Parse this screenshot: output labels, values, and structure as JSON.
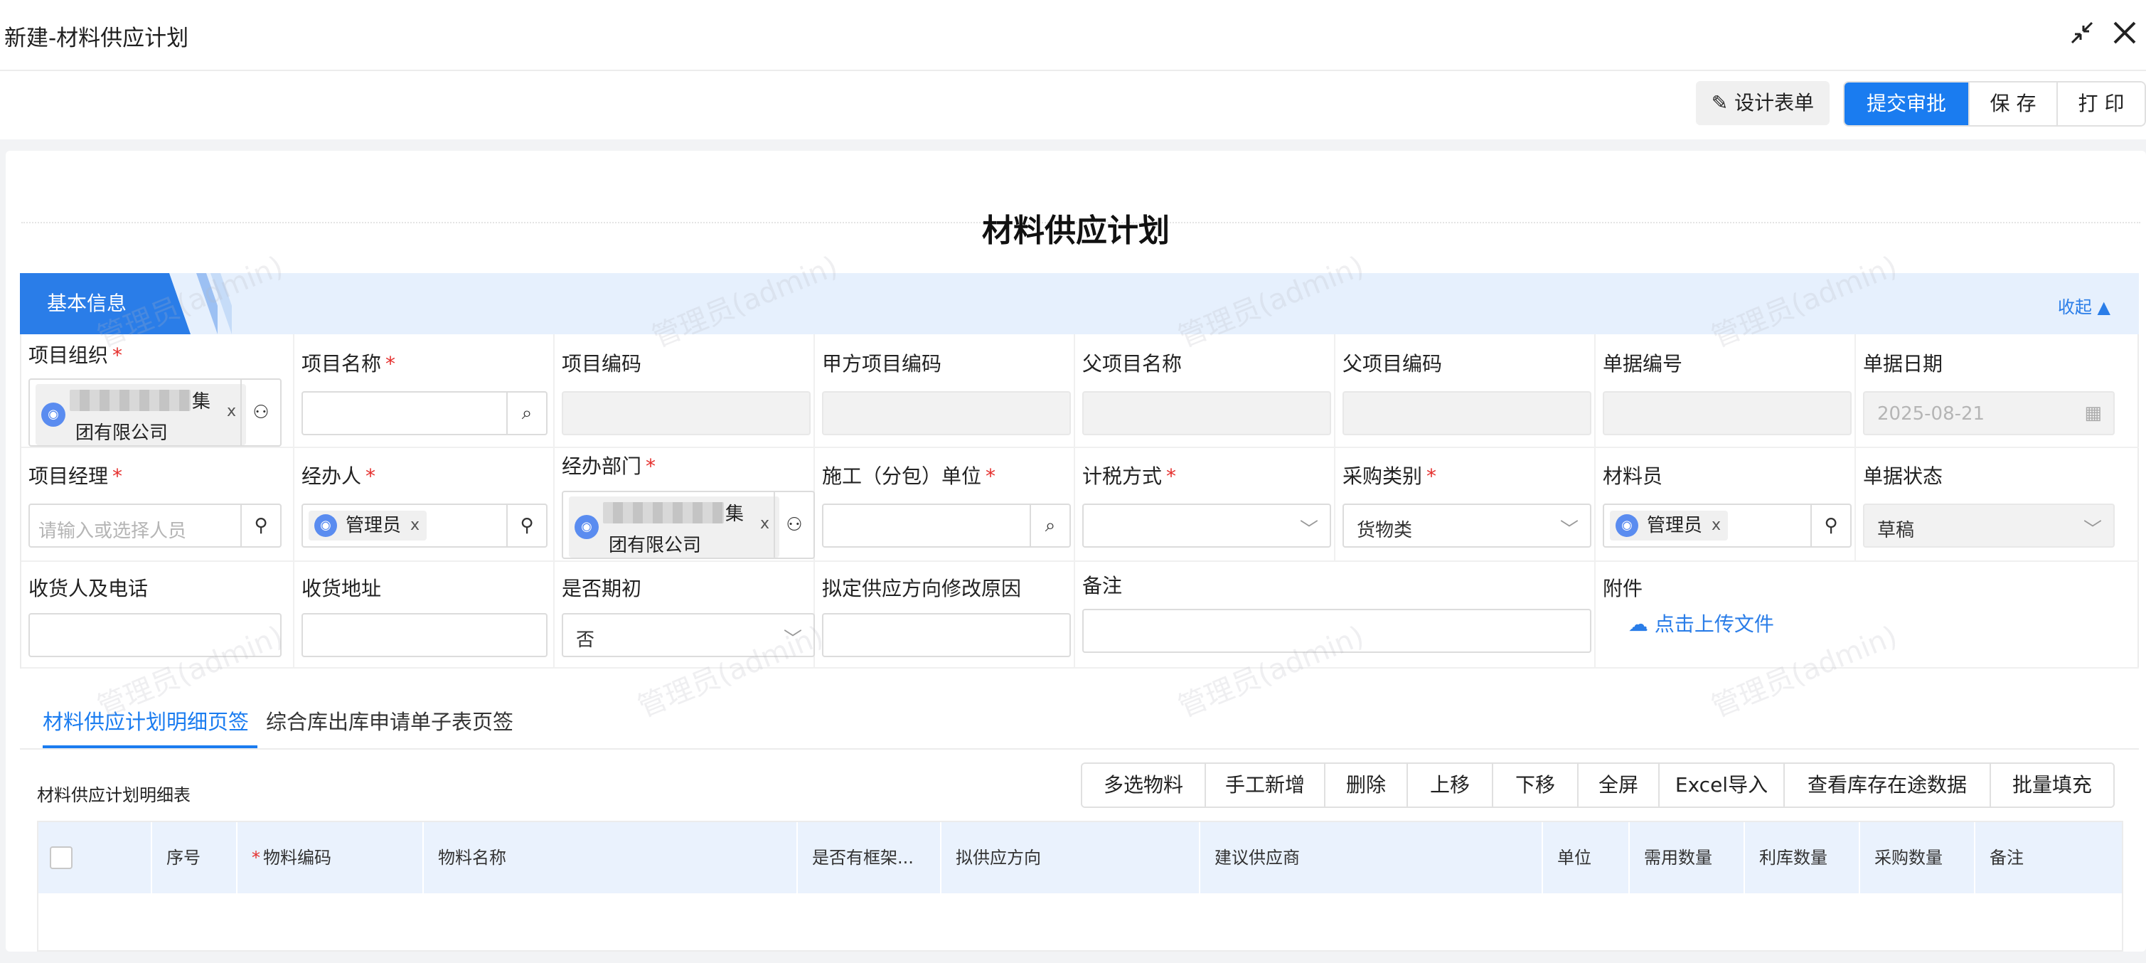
{
  "window": {
    "title": "新建-材料供应计划"
  },
  "toolbar": {
    "design_label": "设计表单",
    "submit_label": "提交审批",
    "save_label": "保 存",
    "print_label": "打 印"
  },
  "form": {
    "title": "材料供应计划"
  },
  "section": {
    "label": "基本信息",
    "collapse_label": "收起 ▲"
  },
  "fields": {
    "project_org": {
      "label": "项目组织",
      "tag_line1": "集",
      "tag_line2": "团有限公司"
    },
    "project_name": {
      "label": "项目名称"
    },
    "project_code": {
      "label": "项目编码"
    },
    "client_project_code": {
      "label": "甲方项目编码"
    },
    "parent_project_name": {
      "label": "父项目名称"
    },
    "parent_project_code": {
      "label": "父项目编码"
    },
    "doc_number": {
      "label": "单据编号"
    },
    "doc_date": {
      "label": "单据日期",
      "value": "2025-08-21"
    },
    "project_manager": {
      "label": "项目经理",
      "placeholder": "请输入或选择人员"
    },
    "handler": {
      "label": "经办人",
      "tag": "管理员"
    },
    "handler_dept": {
      "label": "经办部门",
      "tag_line1": "集",
      "tag_line2": "团有限公司"
    },
    "subcontractor": {
      "label": "施工（分包）单位"
    },
    "tax_method": {
      "label": "计税方式"
    },
    "purchase_type": {
      "label": "采购类别",
      "value": "货物类"
    },
    "material_clerk": {
      "label": "材料员",
      "tag": "管理员"
    },
    "doc_status": {
      "label": "单据状态",
      "value": "草稿"
    },
    "consignee": {
      "label": "收货人及电话"
    },
    "delivery_address": {
      "label": "收货地址"
    },
    "is_initial": {
      "label": "是否期初",
      "value": "否"
    },
    "reason": {
      "label": "拟定供应方向修改原因"
    },
    "remark": {
      "label": "备注"
    },
    "attachment": {
      "label": "附件",
      "upload_label": "点击上传文件"
    }
  },
  "tabs": [
    "材料供应计划明细页签",
    "综合库出库申请单子表页签"
  ],
  "detail": {
    "subtitle": "材料供应计划明细表",
    "buttons": [
      "多选物料",
      "手工新增",
      "删除",
      "上移",
      "下移",
      "全屏",
      "Excel导入",
      "查看库存在途数据",
      "批量填充"
    ],
    "columns": [
      "序号",
      "物料编码",
      "物料名称",
      "是否有框架...",
      "拟供应方向",
      "建议供应商",
      "单位",
      "需用数量",
      "利库数量",
      "采购数量",
      "备注"
    ]
  },
  "watermark": "管理员(admin)",
  "colors": {
    "primary": "#1a7cf0",
    "required": "#e5302e",
    "section_bg": "#e6f0fd"
  }
}
